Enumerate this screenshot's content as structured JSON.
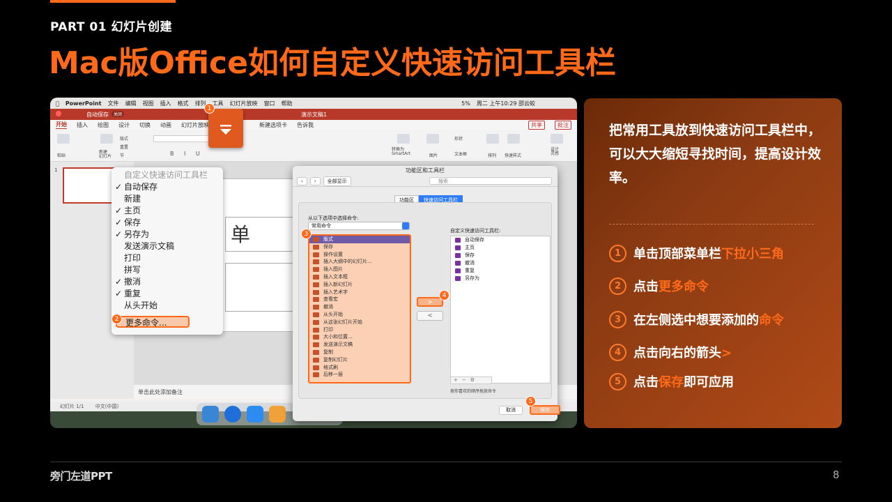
{
  "section_label": "PART 01  幻灯片创建",
  "main_title": "Mac版Office如何自定义快速访问工具栏",
  "screenshot": {
    "mac_menubar": [
      "PowerPoint",
      "文件",
      "编辑",
      "视图",
      "插入",
      "格式",
      "排列",
      "工具",
      "幻灯片放映",
      "窗口",
      "帮助"
    ],
    "mac_status": "周二 上午10:29  邵云蛟",
    "battery": "5%",
    "autosave_label": "自动保存",
    "autosave_state": "关闭",
    "doc_title": "演示文稿1",
    "ribbon_tabs": [
      "开始",
      "插入",
      "绘图",
      "设计",
      "切换",
      "动画",
      "幻灯片放映"
    ],
    "ribbon_right_tabs": [
      "新建选项卡",
      "告诉我"
    ],
    "share_label": "共享",
    "comments_label": "批注",
    "ribbon_groups": {
      "paste": "粘贴",
      "new_slide": "新建\n幻灯片",
      "layout": "版式",
      "reset": "重置",
      "section": "节",
      "convert_smartart": "转换为\nSmartArt",
      "picture": "图片",
      "shapes": "形状",
      "textbox": "文本框",
      "arrange": "排列",
      "quick_styles": "快速样式",
      "design_ideas": "设计\n灵感"
    },
    "slide_thumb_number": "1",
    "slide_placeholder_char": "单",
    "notes_hint": "单击此处添加备注",
    "status_slide": "幻灯片 1/1",
    "status_lang": "中文(中国)",
    "qat_menu": {
      "header": "自定义快速访问工具栏",
      "items": [
        {
          "label": "自动保存",
          "checked": true
        },
        {
          "label": "新建",
          "checked": false
        },
        {
          "label": "主页",
          "checked": true
        },
        {
          "label": "保存",
          "checked": true
        },
        {
          "label": "另存为",
          "checked": true
        },
        {
          "label": "发送演示文稿",
          "checked": false
        },
        {
          "label": "打印",
          "checked": false
        },
        {
          "label": "拼写",
          "checked": false
        },
        {
          "label": "撤消",
          "checked": true
        },
        {
          "label": "重复",
          "checked": true
        },
        {
          "label": "从头开始",
          "checked": false
        }
      ],
      "more_commands": "更多命令..."
    },
    "dialog": {
      "title": "功能区和工具栏",
      "show_all": "全部显示",
      "search_placeholder": "搜索",
      "tabs": [
        "功能区",
        "快速访问工具栏"
      ],
      "choose_label": "从以下选项中选择命令:",
      "choose_value": "常用命令",
      "left_items": [
        "版式",
        "保存",
        "操作设置",
        "插入大纲中的幻灯片...",
        "插入图片",
        "插入文本框",
        "插入新幻灯片",
        "插入艺术字",
        "查看宏",
        "撤消",
        "从头开始",
        "从这张幻灯片开始",
        "打印",
        "大小和位置...",
        "发送演示文稿",
        "复制",
        "复制幻灯片",
        "格式刷",
        "后移一层"
      ],
      "right_label": "自定义快速访问工具栏:",
      "right_items": [
        "自动保存",
        "主页",
        "保存",
        "撤消",
        "重复",
        "另存为"
      ],
      "add_arrow": ">",
      "remove_arrow": "<",
      "order_hint": "按你喜欢的顺序拖放命令",
      "cancel": "取消",
      "save": "保存"
    },
    "markers": [
      "1",
      "2",
      "3",
      "4",
      "5"
    ]
  },
  "instructions": {
    "intro": "把常用工具放到快速访问工具栏中，可以大大缩短寻找时间，提高设计效率。",
    "steps": [
      {
        "num": "1",
        "pre": "单击顶部菜单栏",
        "hl": "下拉小三角",
        "post": ""
      },
      {
        "num": "2",
        "pre": "点击",
        "hl": "更多命令",
        "post": ""
      },
      {
        "num": "3",
        "pre": "在左侧选中想要添加的",
        "hl": "命令",
        "post": ""
      },
      {
        "num": "4",
        "pre": "点击向右的箭头",
        "hl": ">",
        "post": ""
      },
      {
        "num": "5",
        "pre": "点击",
        "hl": "保存",
        "post": "即可应用"
      }
    ]
  },
  "footer": {
    "brand": "旁门左道PPT",
    "page": "8"
  },
  "colors": {
    "accent": "#ff6a1a",
    "panel": "#8a3a12",
    "background": "#000000"
  }
}
